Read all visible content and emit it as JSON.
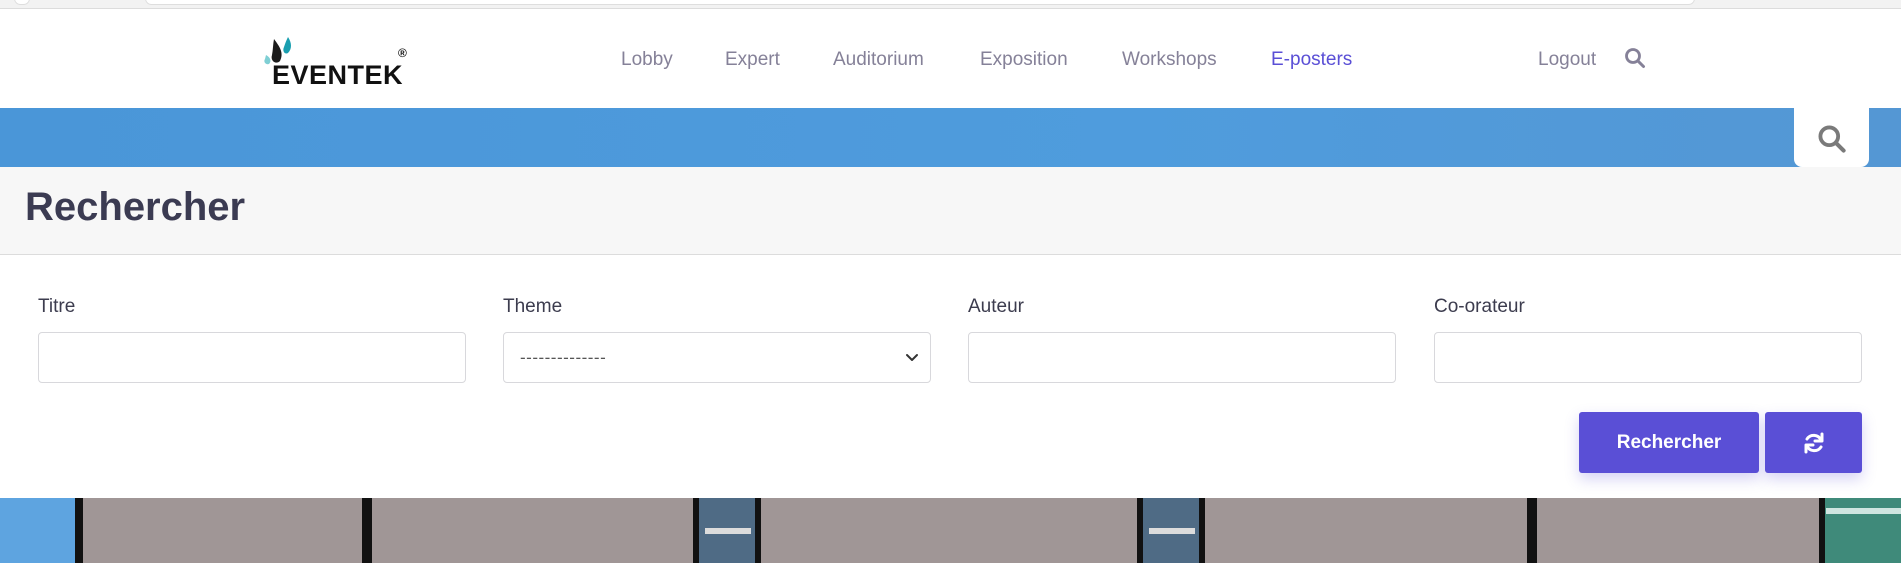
{
  "brand": {
    "name": "EVENTEK",
    "mark": "®"
  },
  "nav": {
    "items": [
      {
        "label": "Lobby",
        "active": false
      },
      {
        "label": "Expert",
        "active": false
      },
      {
        "label": "Auditorium",
        "active": false
      },
      {
        "label": "Exposition",
        "active": false
      },
      {
        "label": "Workshops",
        "active": false
      },
      {
        "label": "E-posters",
        "active": true
      }
    ],
    "logout": "Logout",
    "search_icon": "search-icon"
  },
  "page": {
    "title": "Rechercher"
  },
  "form": {
    "titre": {
      "label": "Titre",
      "value": ""
    },
    "theme": {
      "label": "Theme",
      "selected": "--------------"
    },
    "auteur": {
      "label": "Auteur",
      "value": ""
    },
    "coorateur": {
      "label": "Co-orateur",
      "value": ""
    },
    "submit_label": "Rechercher",
    "reset_icon": "refresh-icon"
  },
  "colors": {
    "accent": "#5a4fd6",
    "banner": "#4f9cdd",
    "nav_text": "#858198"
  }
}
